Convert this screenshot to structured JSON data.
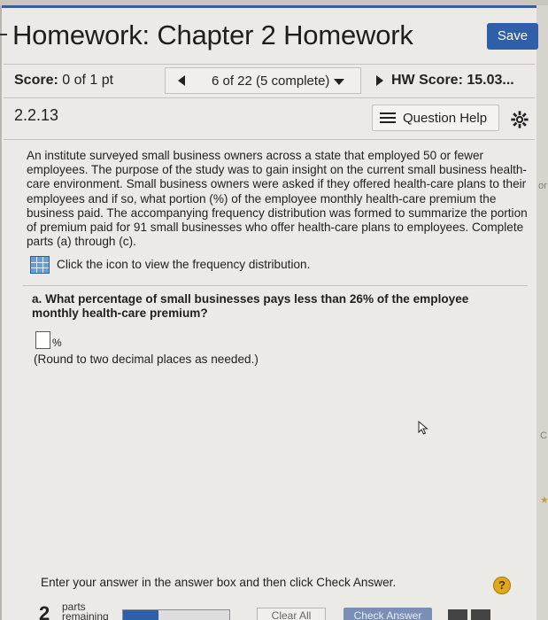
{
  "header": {
    "title": "Homework: Chapter 2 Homework",
    "save_label": "Save"
  },
  "score_bar": {
    "score_label": "Score:",
    "score_value": "0 of 1 pt",
    "question_nav": "6 of 22 (5 complete)",
    "hw_score_label": "HW Score:",
    "hw_score_value": "15.03..."
  },
  "question_bar": {
    "number": "2.2.13",
    "help_label": "Question Help"
  },
  "question": {
    "body": "An institute surveyed small business owners across a state that employed 50 or fewer employees. The purpose of the study was to gain insight on the current small business health-care environment. Small business owners were asked if they offered health-care plans to their employees and if so, what portion (%) of the employee monthly health-care premium the business paid. The accompanying frequency distribution was formed to summarize the portion of premium paid for 91 small businesses who offer health-care plans to employees. Complete parts (a) through (c).",
    "freq_link": "Click the icon to view the frequency distribution.",
    "part_a": "a. What percentage of small businesses pays less than 26% of the employee monthly health-care premium?",
    "answer_value": "",
    "unit": "%",
    "round_note": "(Round to two decimal places as needed.)"
  },
  "footer": {
    "instruction": "Enter your answer in the answer box and then click Check Answer.",
    "hint_symbol": "?",
    "parts_count": "2",
    "parts_label_1": "parts",
    "parts_label_2": "remaining",
    "progress_fraction": 0.33,
    "clear_label": "Clear All",
    "check_label": "Check Answer"
  },
  "edge_glyphs": {
    "top": "or",
    "middle": "C",
    "bottom": "★"
  },
  "colors": {
    "accent": "#2e5fa8",
    "hint": "#e0a81a",
    "background": "#eceae6"
  }
}
